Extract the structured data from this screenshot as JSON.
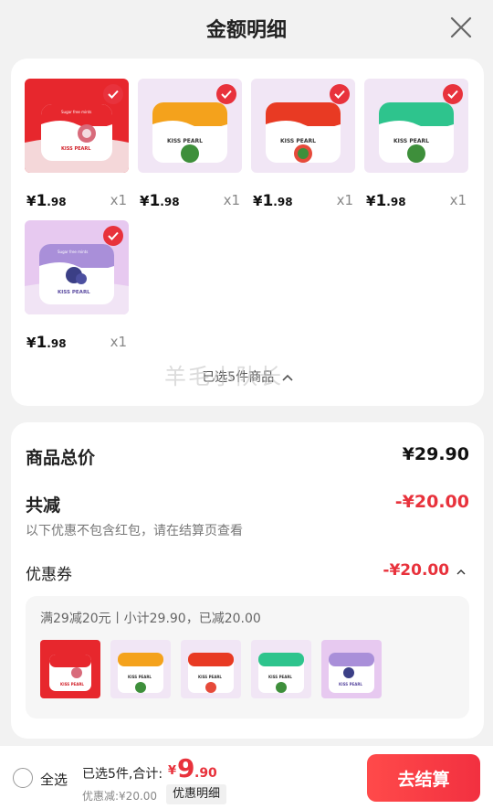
{
  "header": {
    "title": "金额明细",
    "close_icon": "close-icon"
  },
  "products": [
    {
      "theme": "red",
      "bg": "#e7272d",
      "lid": "#e7272d",
      "fruit": "lychee",
      "price_currency": "¥",
      "price_int": "1",
      "price_dec": ".98",
      "qty": "x1",
      "checked": true
    },
    {
      "theme": "orange",
      "bg": "#f1e6f5",
      "lid": "#f4a21c",
      "fruit": "orange",
      "price_currency": "¥",
      "price_int": "1",
      "price_dec": ".98",
      "qty": "x1",
      "checked": true
    },
    {
      "theme": "watermelon",
      "bg": "#f1e6f5",
      "lid": "#e83a23",
      "fruit": "watermelon",
      "price_currency": "¥",
      "price_int": "1",
      "price_dec": ".98",
      "qty": "x1",
      "checked": true
    },
    {
      "theme": "mint",
      "bg": "#f1e6f5",
      "lid": "#2ec48d",
      "fruit": "mint",
      "price_currency": "¥",
      "price_int": "1",
      "price_dec": ".98",
      "qty": "x1",
      "checked": true
    },
    {
      "theme": "blueberry",
      "bg": "#e7c9f0",
      "lid": "#a98fd9",
      "fruit": "blueberry",
      "price_currency": "¥",
      "price_int": "1",
      "price_dec": ".98",
      "qty": "x1",
      "checked": true
    }
  ],
  "collapse_label": "已选5件商品",
  "watermark": "羊毛小队长",
  "summary": {
    "total_label": "商品总价",
    "total_value": "¥29.90",
    "discount_label": "共减",
    "discount_value": "-¥20.00",
    "hint": "以下优惠不包含红包，请在结算页查看",
    "coupon_label": "优惠券",
    "coupon_value": "-¥20.00",
    "coupon_desc": "满29减20元丨小计29.90，已减20.00"
  },
  "bottom": {
    "select_all": "全选",
    "selected_text": "已选5件,合计:",
    "total_currency": "¥",
    "total_int": "9",
    "total_dec": ".90",
    "saved_text": "优惠减:¥20.00",
    "detail_button": "优惠明细",
    "checkout_button": "去结算"
  },
  "colors": {
    "accent": "#e8323c",
    "card": "#ffffff",
    "page": "#f2f2f2"
  }
}
